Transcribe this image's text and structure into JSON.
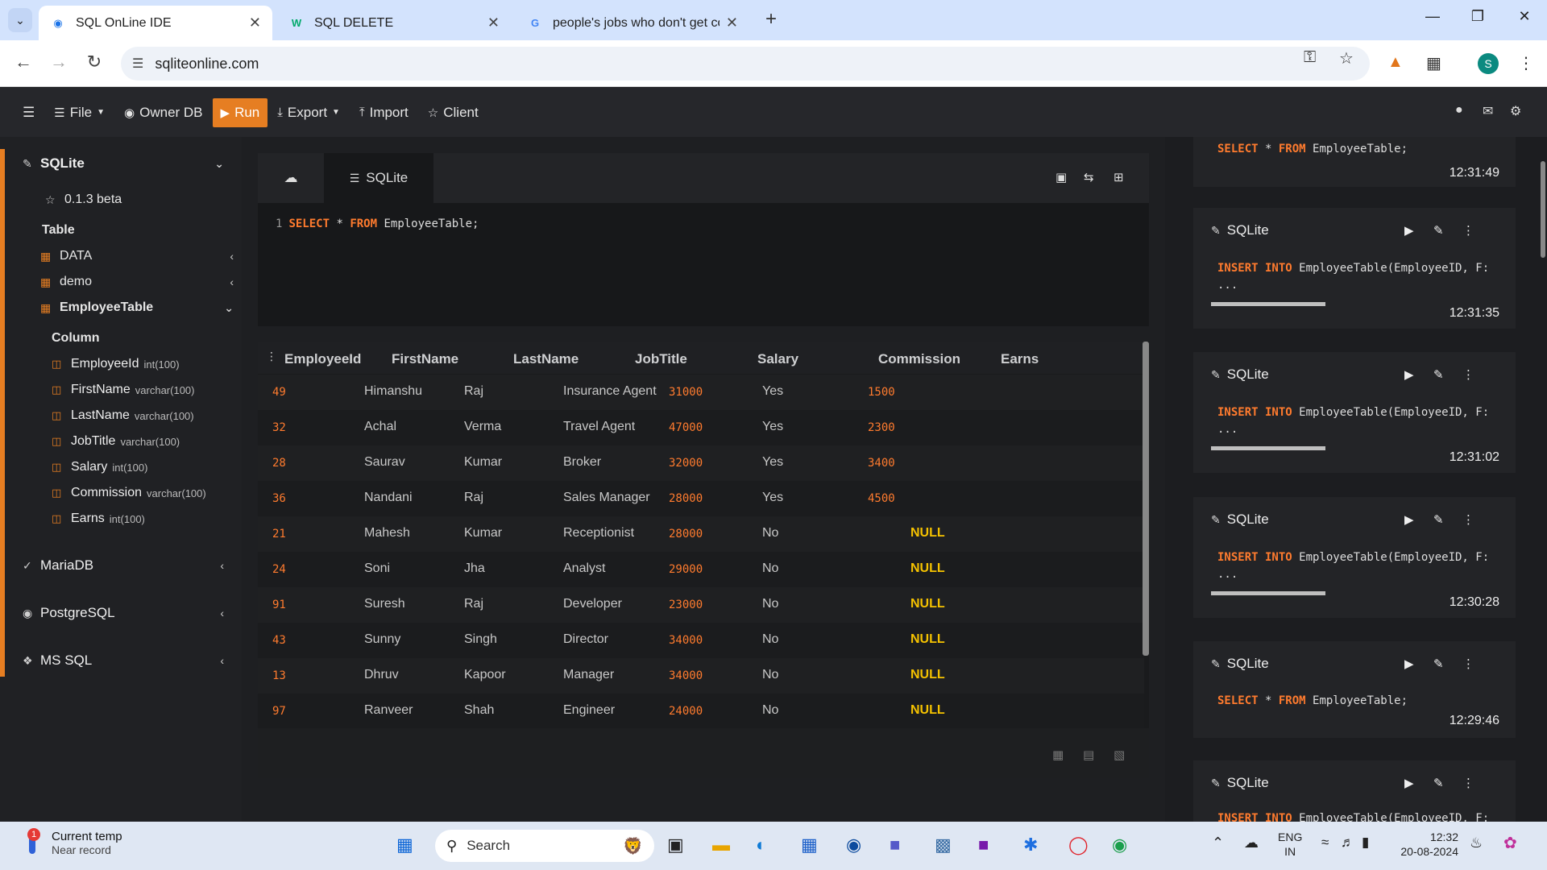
{
  "browser": {
    "tabs": [
      {
        "title": "SQL OnLine IDE",
        "favicon": "sqlonline-favicon",
        "active": true
      },
      {
        "title": "SQL DELETE",
        "favicon": "w3schools-favicon",
        "active": false
      },
      {
        "title": "people's jobs who don't get co",
        "favicon": "google-favicon",
        "active": false
      }
    ],
    "url": "sqliteonline.com",
    "profile_initial": "S"
  },
  "toolbar": {
    "file": "File",
    "owner_db": "Owner DB",
    "run": "Run",
    "export": "Export",
    "import": "Import",
    "client": "Client"
  },
  "sidebar": {
    "sqlite": {
      "title": "SQLite",
      "version": "0.1.3 beta",
      "table_header": "Table",
      "tables": [
        "DATA",
        "demo",
        "EmployeeTable"
      ],
      "column_header": "Column",
      "columns": [
        {
          "name": "EmployeeId",
          "type": "int(100)"
        },
        {
          "name": "FirstName",
          "type": "varchar(100)"
        },
        {
          "name": "LastName",
          "type": "varchar(100)"
        },
        {
          "name": "JobTitle",
          "type": "varchar(100)"
        },
        {
          "name": "Salary",
          "type": "int(100)"
        },
        {
          "name": "Commission",
          "type": "varchar(100)"
        },
        {
          "name": "Earns",
          "type": "int(100)"
        }
      ]
    },
    "other_dbs": [
      "MariaDB",
      "PostgreSQL",
      "MS SQL"
    ]
  },
  "editor": {
    "tab_label": "SQLite",
    "line_number": "1",
    "code": {
      "kw1": "SELECT",
      "mid": " * ",
      "kw2": "FROM",
      "rest": " EmployeeTable;"
    }
  },
  "results": {
    "headers": [
      "EmployeeId",
      "FirstName",
      "LastName",
      "JobTitle",
      "Salary",
      "Commission",
      "Earns"
    ],
    "rows": [
      [
        "49",
        "Himanshu",
        "Raj",
        "Insurance Agent",
        "31000",
        "Yes",
        "1500"
      ],
      [
        "32",
        "Achal",
        "Verma",
        "Travel Agent",
        "47000",
        "Yes",
        "2300"
      ],
      [
        "28",
        "Saurav",
        "Kumar",
        "Broker",
        "32000",
        "Yes",
        "3400"
      ],
      [
        "36",
        "Nandani",
        "Raj",
        "Sales Manager",
        "28000",
        "Yes",
        "4500"
      ],
      [
        "21",
        "Mahesh",
        "Kumar",
        "Receptionist",
        "28000",
        "No",
        "NULL"
      ],
      [
        "24",
        "Soni",
        "Jha",
        "Analyst",
        "29000",
        "No",
        "NULL"
      ],
      [
        "91",
        "Suresh",
        "Raj",
        "Developer",
        "23000",
        "No",
        "NULL"
      ],
      [
        "43",
        "Sunny",
        "Singh",
        "Director",
        "34000",
        "No",
        "NULL"
      ],
      [
        "13",
        "Dhruv",
        "Kapoor",
        "Manager",
        "34000",
        "No",
        "NULL"
      ],
      [
        "97",
        "Ranveer",
        "Shah",
        "Engineer",
        "24000",
        "No",
        "NULL"
      ]
    ]
  },
  "history": {
    "top": {
      "kw1": "SELECT",
      "mid": " * ",
      "kw2": "FROM",
      "rest": " EmployeeTable;",
      "time": "12:31:49"
    },
    "cards": [
      {
        "title": "SQLite",
        "kw": "INSERT INTO",
        "rest": " EmployeeTable(EmployeeID, F:",
        "more": "...",
        "time": "12:31:35"
      },
      {
        "title": "SQLite",
        "kw": "INSERT INTO",
        "rest": " EmployeeTable(EmployeeID, F:",
        "more": "...",
        "time": "12:31:02"
      },
      {
        "title": "SQLite",
        "kw": "INSERT INTO",
        "rest": " EmployeeTable(EmployeeID, F:",
        "more": "...",
        "time": "12:30:28"
      },
      {
        "title": "SQLite",
        "kw1": "SELECT",
        "mid": " * ",
        "kw2": "FROM",
        "rest": " EmployeeTable;",
        "time": "12:29:46"
      },
      {
        "title": "SQLite",
        "kw": "INSERT INTO",
        "rest": " EmployeeTable(EmployeeID, F:"
      }
    ]
  },
  "taskbar": {
    "weather_title": "Current temp",
    "weather_sub": "Near record",
    "weather_badge": "1",
    "search_placeholder": "Search",
    "lang1": "ENG",
    "lang2": "IN",
    "time": "12:32",
    "date": "20-08-2024"
  },
  "colors": {
    "accent": "#e67e22",
    "keyword": "#ff7b2e",
    "null": "#f5c200"
  }
}
